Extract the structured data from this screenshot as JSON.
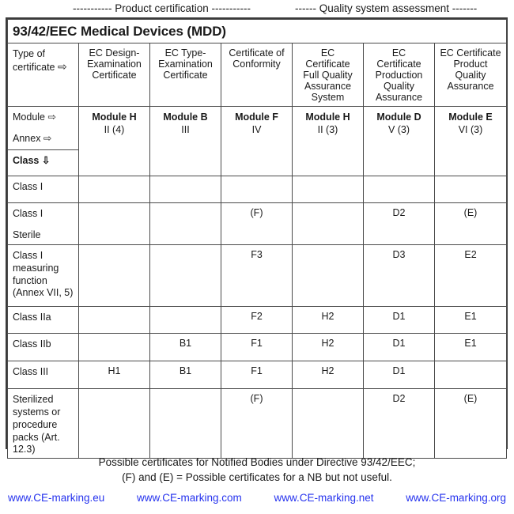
{
  "groups": {
    "left": "----------- Product certification  -----------",
    "right": "------ Quality system assessment -------"
  },
  "table": {
    "title": "93/42/EEC Medical Devices (MDD)",
    "header_row": {
      "row_label_line1": "Type of",
      "row_label_line2": "certificate",
      "row_label_arrow": "⇨",
      "columns": [
        "EC Design-Examination Certificate",
        "EC Type-Examination Certificate",
        "Certificate of Conformity",
        "EC Certificate Full Quality Assurance System",
        "EC Certificate Production Quality Assurance",
        "EC Certificate Product Quality Assurance"
      ]
    },
    "module_row": {
      "label_module": "Module ⇨",
      "label_annex": "Annex ⇨",
      "label_class": "Class ⇩",
      "modules": [
        "Module H",
        "Module B",
        "Module F",
        "Module H",
        "Module D",
        "Module E"
      ],
      "annexes": [
        "II (4)",
        "III",
        "IV",
        "II (3)",
        "V (3)",
        "VI (3)"
      ]
    },
    "rows": [
      {
        "label": "Class I",
        "sub": "",
        "cells": [
          {
            "value": "",
            "gray": true
          },
          {
            "value": "",
            "gray": true
          },
          {
            "value": "",
            "gray": true
          },
          {
            "value": "",
            "gray": true
          },
          {
            "value": "",
            "gray": true
          },
          {
            "value": "",
            "gray": true
          }
        ]
      },
      {
        "label": "Class I",
        "label2": "Sterile",
        "sub": "",
        "cells": [
          {
            "value": "",
            "gray": true
          },
          {
            "value": "",
            "gray": true
          },
          {
            "value": "(F)",
            "gray": false
          },
          {
            "value": "",
            "gray": true
          },
          {
            "value": "D2",
            "gray": false
          },
          {
            "value": "(E)",
            "gray": false
          }
        ]
      },
      {
        "label": "Class I measuring function",
        "sub": "(Annex VII, 5)",
        "cells": [
          {
            "value": "",
            "gray": true
          },
          {
            "value": "",
            "gray": true
          },
          {
            "value": "F3",
            "gray": false
          },
          {
            "value": "",
            "gray": true
          },
          {
            "value": "D3",
            "gray": false
          },
          {
            "value": "E2",
            "gray": false
          }
        ]
      },
      {
        "label": "Class IIa",
        "sub": "",
        "cells": [
          {
            "value": "",
            "gray": true
          },
          {
            "value": "",
            "gray": true
          },
          {
            "value": "F2",
            "gray": false
          },
          {
            "value": "H2",
            "gray": false
          },
          {
            "value": "D1",
            "gray": false
          },
          {
            "value": "E1",
            "gray": false
          }
        ]
      },
      {
        "label": "Class IIb",
        "sub": "",
        "cells": [
          {
            "value": "",
            "gray": true
          },
          {
            "value": "B1",
            "gray": false
          },
          {
            "value": "F1",
            "gray": false
          },
          {
            "value": "H2",
            "gray": false
          },
          {
            "value": "D1",
            "gray": false
          },
          {
            "value": "E1",
            "gray": false
          }
        ]
      },
      {
        "label": "Class III",
        "sub": "",
        "cells": [
          {
            "value": "H1",
            "gray": false
          },
          {
            "value": "B1",
            "gray": false
          },
          {
            "value": "F1",
            "gray": false
          },
          {
            "value": "H2",
            "gray": false
          },
          {
            "value": "D1",
            "gray": false
          },
          {
            "value": "",
            "gray": true
          }
        ]
      },
      {
        "label": "Sterilized systems or procedure packs",
        "sub": "(Art. 12.3)",
        "cells": [
          {
            "value": "",
            "gray": true
          },
          {
            "value": "",
            "gray": true
          },
          {
            "value": "(F)",
            "gray": false
          },
          {
            "value": "",
            "gray": true
          },
          {
            "value": "D2",
            "gray": false
          },
          {
            "value": "(E)",
            "gray": false
          }
        ]
      }
    ]
  },
  "footer": {
    "line1": "Possible certificates for Notified Bodies under Directive 93/42/EEC;",
    "line2": "(F) and (E) = Possible certificates for a NB but not useful."
  },
  "links": [
    "www.CE-marking.eu",
    "www.CE-marking.com",
    "www.CE-marking.net",
    "www.CE-marking.org"
  ],
  "colors": {
    "link": "#2633ee",
    "gray_cell": "#e0e0e0",
    "border": "#4a4a4a"
  }
}
